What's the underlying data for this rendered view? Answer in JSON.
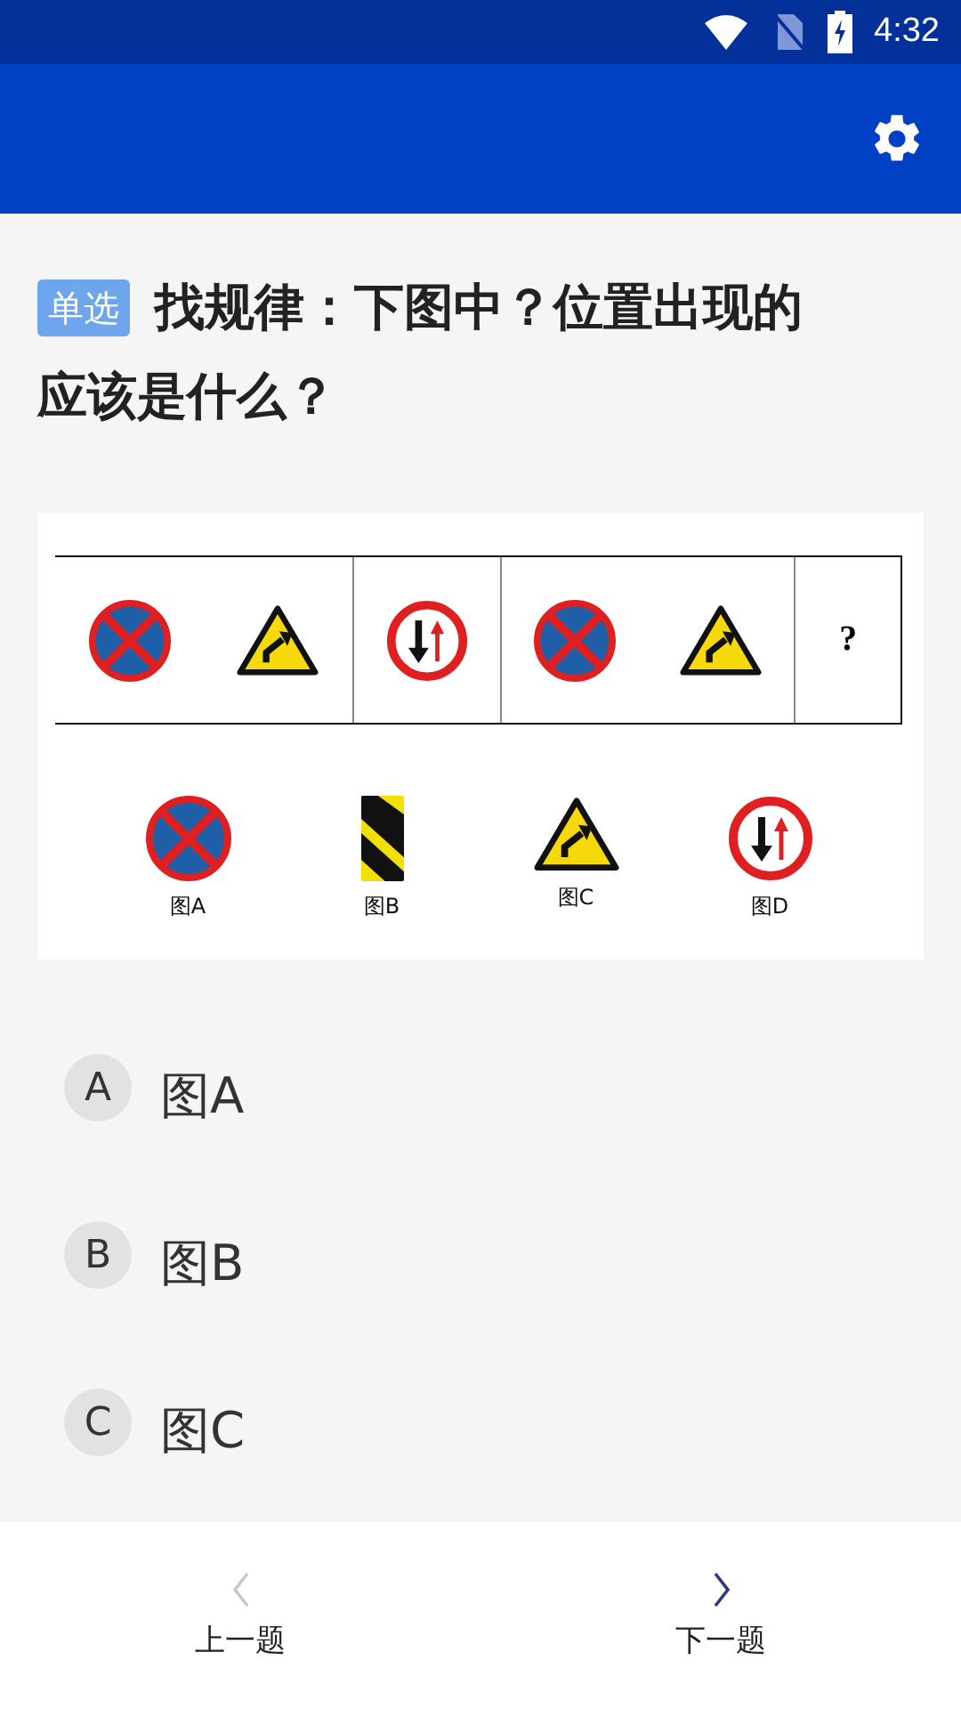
{
  "status_bar": {
    "time": "4:32"
  },
  "question": {
    "type_tag": "单选",
    "text_lines": [
      "找规律：下图中？位置出现的",
      "应该是什么？"
    ]
  },
  "figure": {
    "sequence": [
      {
        "signs": [
          {
            "kind": "no-stopping"
          },
          {
            "kind": "curve-warning"
          }
        ]
      },
      {
        "signs": [
          {
            "kind": "priority-oncoming"
          }
        ]
      },
      {
        "signs": [
          {
            "kind": "no-stopping"
          },
          {
            "kind": "curve-warning"
          }
        ]
      },
      {
        "text": "?"
      }
    ],
    "choices": [
      {
        "kind": "no-stopping",
        "label": "图A"
      },
      {
        "kind": "hazard-stripes",
        "label": "图B"
      },
      {
        "kind": "curve-warning",
        "label": "图C"
      },
      {
        "kind": "priority-oncoming",
        "label": "图D"
      }
    ]
  },
  "options": [
    {
      "letter": "A",
      "text": "图A"
    },
    {
      "letter": "B",
      "text": "图B"
    },
    {
      "letter": "C",
      "text": "图C"
    }
  ],
  "nav": {
    "prev": {
      "label": "上一题",
      "disabled": true
    },
    "next": {
      "label": "下一题",
      "disabled": false
    }
  }
}
